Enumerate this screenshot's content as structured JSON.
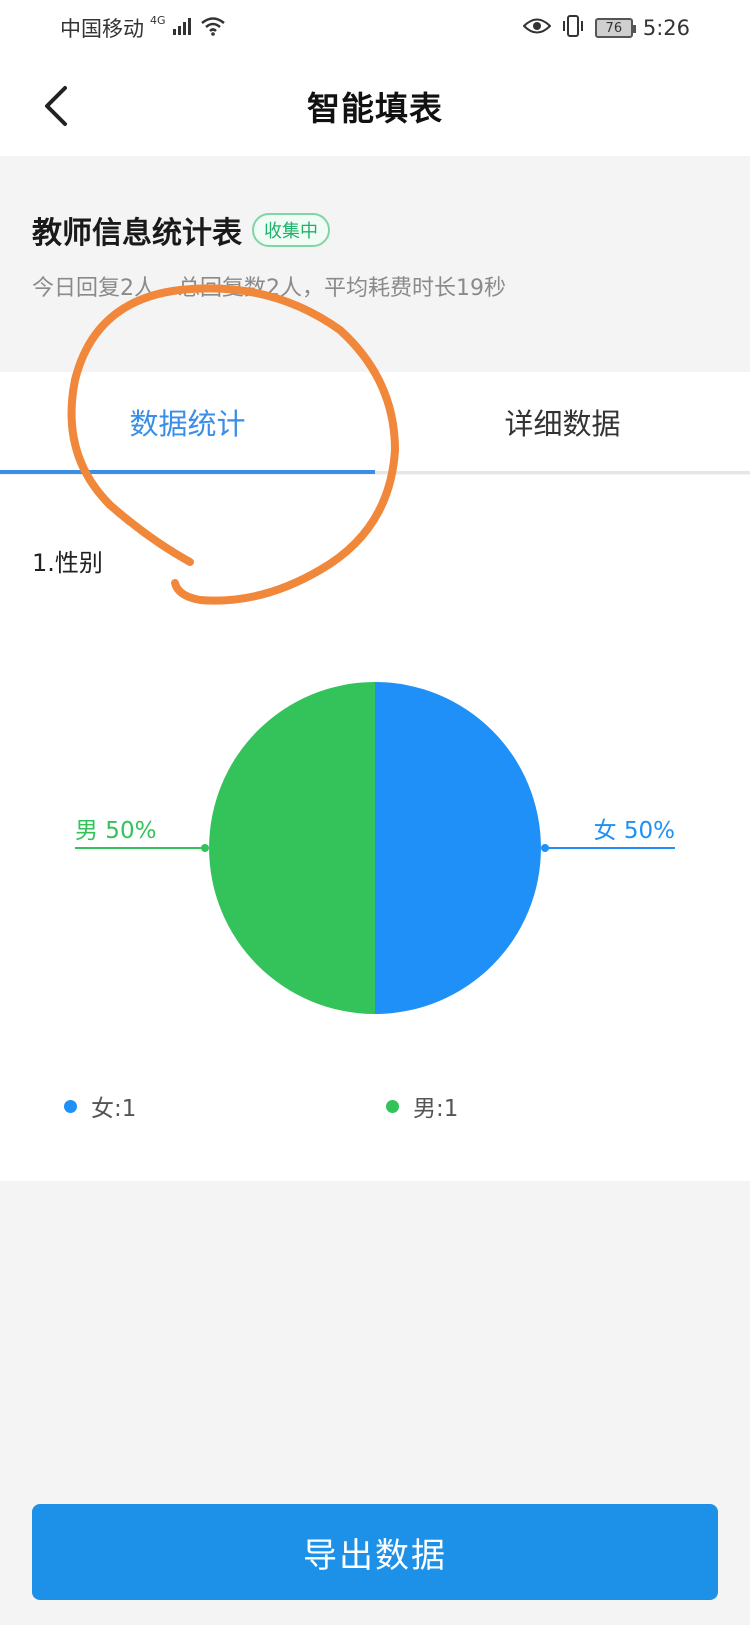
{
  "status_bar": {
    "carrier": "中国移动",
    "network": "4G",
    "battery": "76",
    "time": "5:26"
  },
  "nav": {
    "title": "智能填表",
    "back_icon": "chevron-left-icon"
  },
  "form": {
    "title": "教师信息统计表",
    "status": "收集中",
    "stats": "今日回复2人，总回复数2人，平均耗费时长19秒"
  },
  "tabs": [
    {
      "label": "数据统计",
      "active": true
    },
    {
      "label": "详细数据",
      "active": false
    }
  ],
  "question": {
    "title": "1.性别"
  },
  "chart_data": {
    "type": "pie",
    "slices": [
      {
        "name": "女",
        "value": 1,
        "percent": 50,
        "label": "女 50%",
        "color": "#1e90f7"
      },
      {
        "name": "男",
        "value": 1,
        "percent": 50,
        "label": "男 50%",
        "color": "#34c25a"
      }
    ],
    "legend": [
      {
        "text": "女:1",
        "color": "#1e90f7"
      },
      {
        "text": "男:1",
        "color": "#34c25a"
      }
    ],
    "legend_position": "bottom"
  },
  "footer": {
    "export_label": "导出数据"
  },
  "colors": {
    "accent": "#3a8ee6",
    "button": "#1d90e8",
    "annotation": "#f0873a"
  }
}
